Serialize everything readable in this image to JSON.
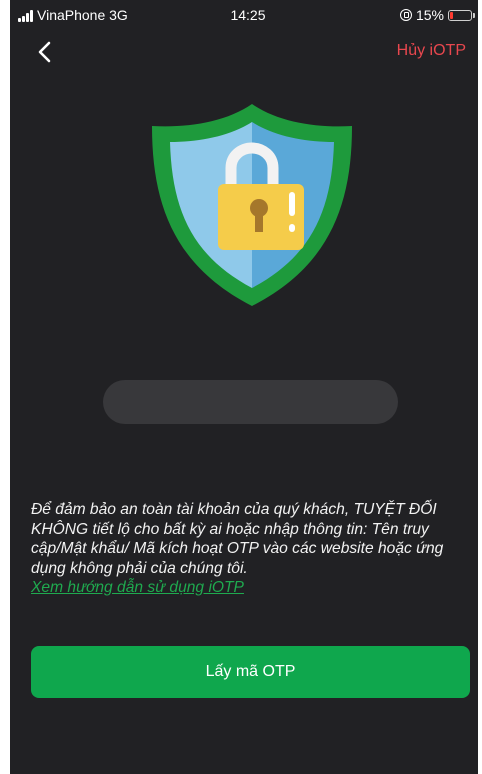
{
  "status_bar": {
    "carrier": "VinaPhone 3G",
    "time": "14:25",
    "battery_percent": "15%",
    "battery_level": 0.15,
    "signal_icon": "signal-bars-icon",
    "orientation_icon": "orientation-lock-icon",
    "battery_icon": "battery-low-icon",
    "battery_color": "#ff3b30"
  },
  "nav": {
    "back_icon": "chevron-left-icon",
    "cancel_label": "Hủy iOTP",
    "cancel_color": "#e8474e"
  },
  "hero": {
    "icon": "shield-lock-icon",
    "colors": {
      "shield_outer": "#1e9a3c",
      "shield_inner_light": "#8fc9ea",
      "shield_inner_dark": "#5aa8d8",
      "lock_body": "#f5cc4a",
      "lock_shackle": "#f2f2f2",
      "keyhole": "#a5772b"
    }
  },
  "notice": {
    "text": "Để đảm bảo an toàn tài khoản của quý khách, TUYỆT ĐỐI KHÔNG tiết lộ cho bất kỳ ai hoặc nhập thông tin: Tên truy cập/Mật khẩu/ Mã kích hoạt OTP vào các website hoặc ứng dụng không phải của chúng tôi.",
    "link_label": "Xem hướng dẫn sử dụng iOTP",
    "link_color": "#1faa4f"
  },
  "primary_button": {
    "label": "Lấy mã OTP",
    "color": "#0fa74d"
  },
  "theme": {
    "background": "#212124",
    "placeholder_bar": "#38383b"
  }
}
